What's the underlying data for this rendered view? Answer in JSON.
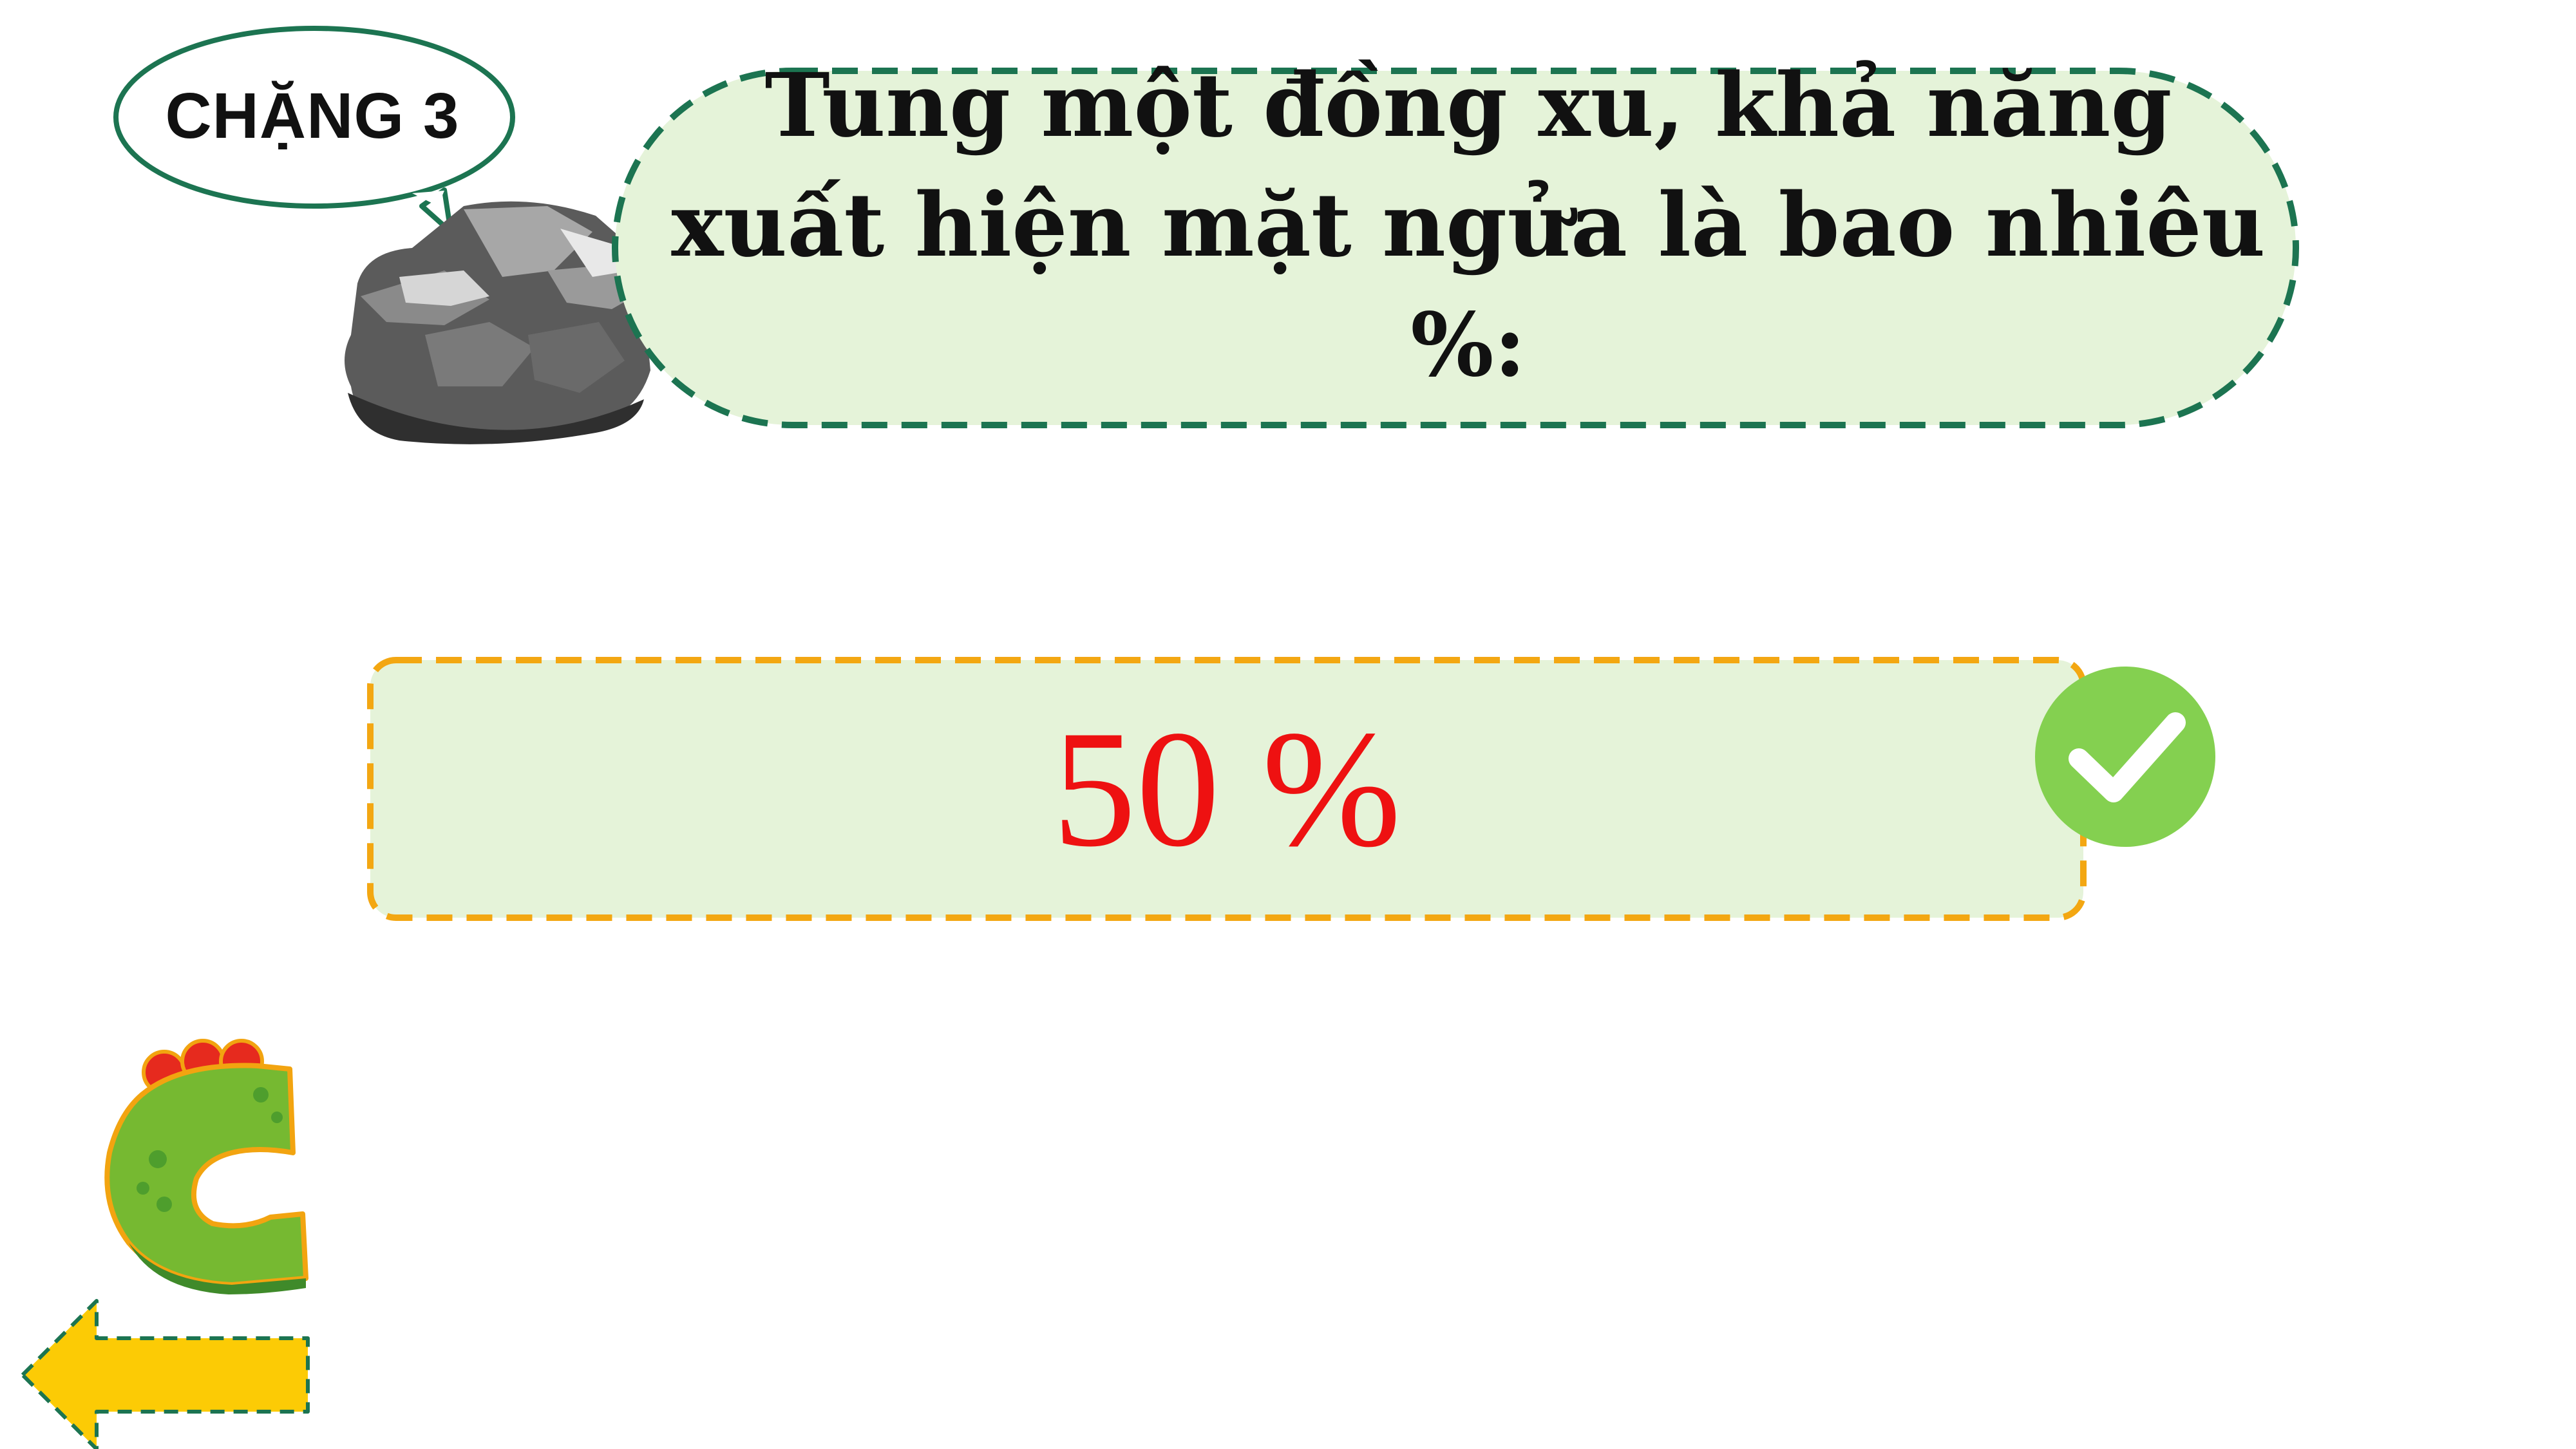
{
  "stage": {
    "label": "CHẶNG 3"
  },
  "question": {
    "text": "Tung một đồng xu, khả năng xuất hiện mặt ngửa là bao nhiêu %:"
  },
  "answer": {
    "text": "50 %",
    "status": "correct"
  },
  "icons": {
    "stage_bubble": "speech-bubble-icon",
    "rock": "rock-icon",
    "check": "check-circle-icon",
    "letter": "letter-c-dinosaur-icon",
    "back": "arrow-left-icon"
  },
  "colors": {
    "question_bg": "#e5f3d9",
    "question_border": "#1c7451",
    "answer_bg": "#e5f3d9",
    "answer_border": "#f3a712",
    "answer_text": "#ee1111",
    "check_green": "#84d050",
    "back_arrow": "#fccb05"
  }
}
